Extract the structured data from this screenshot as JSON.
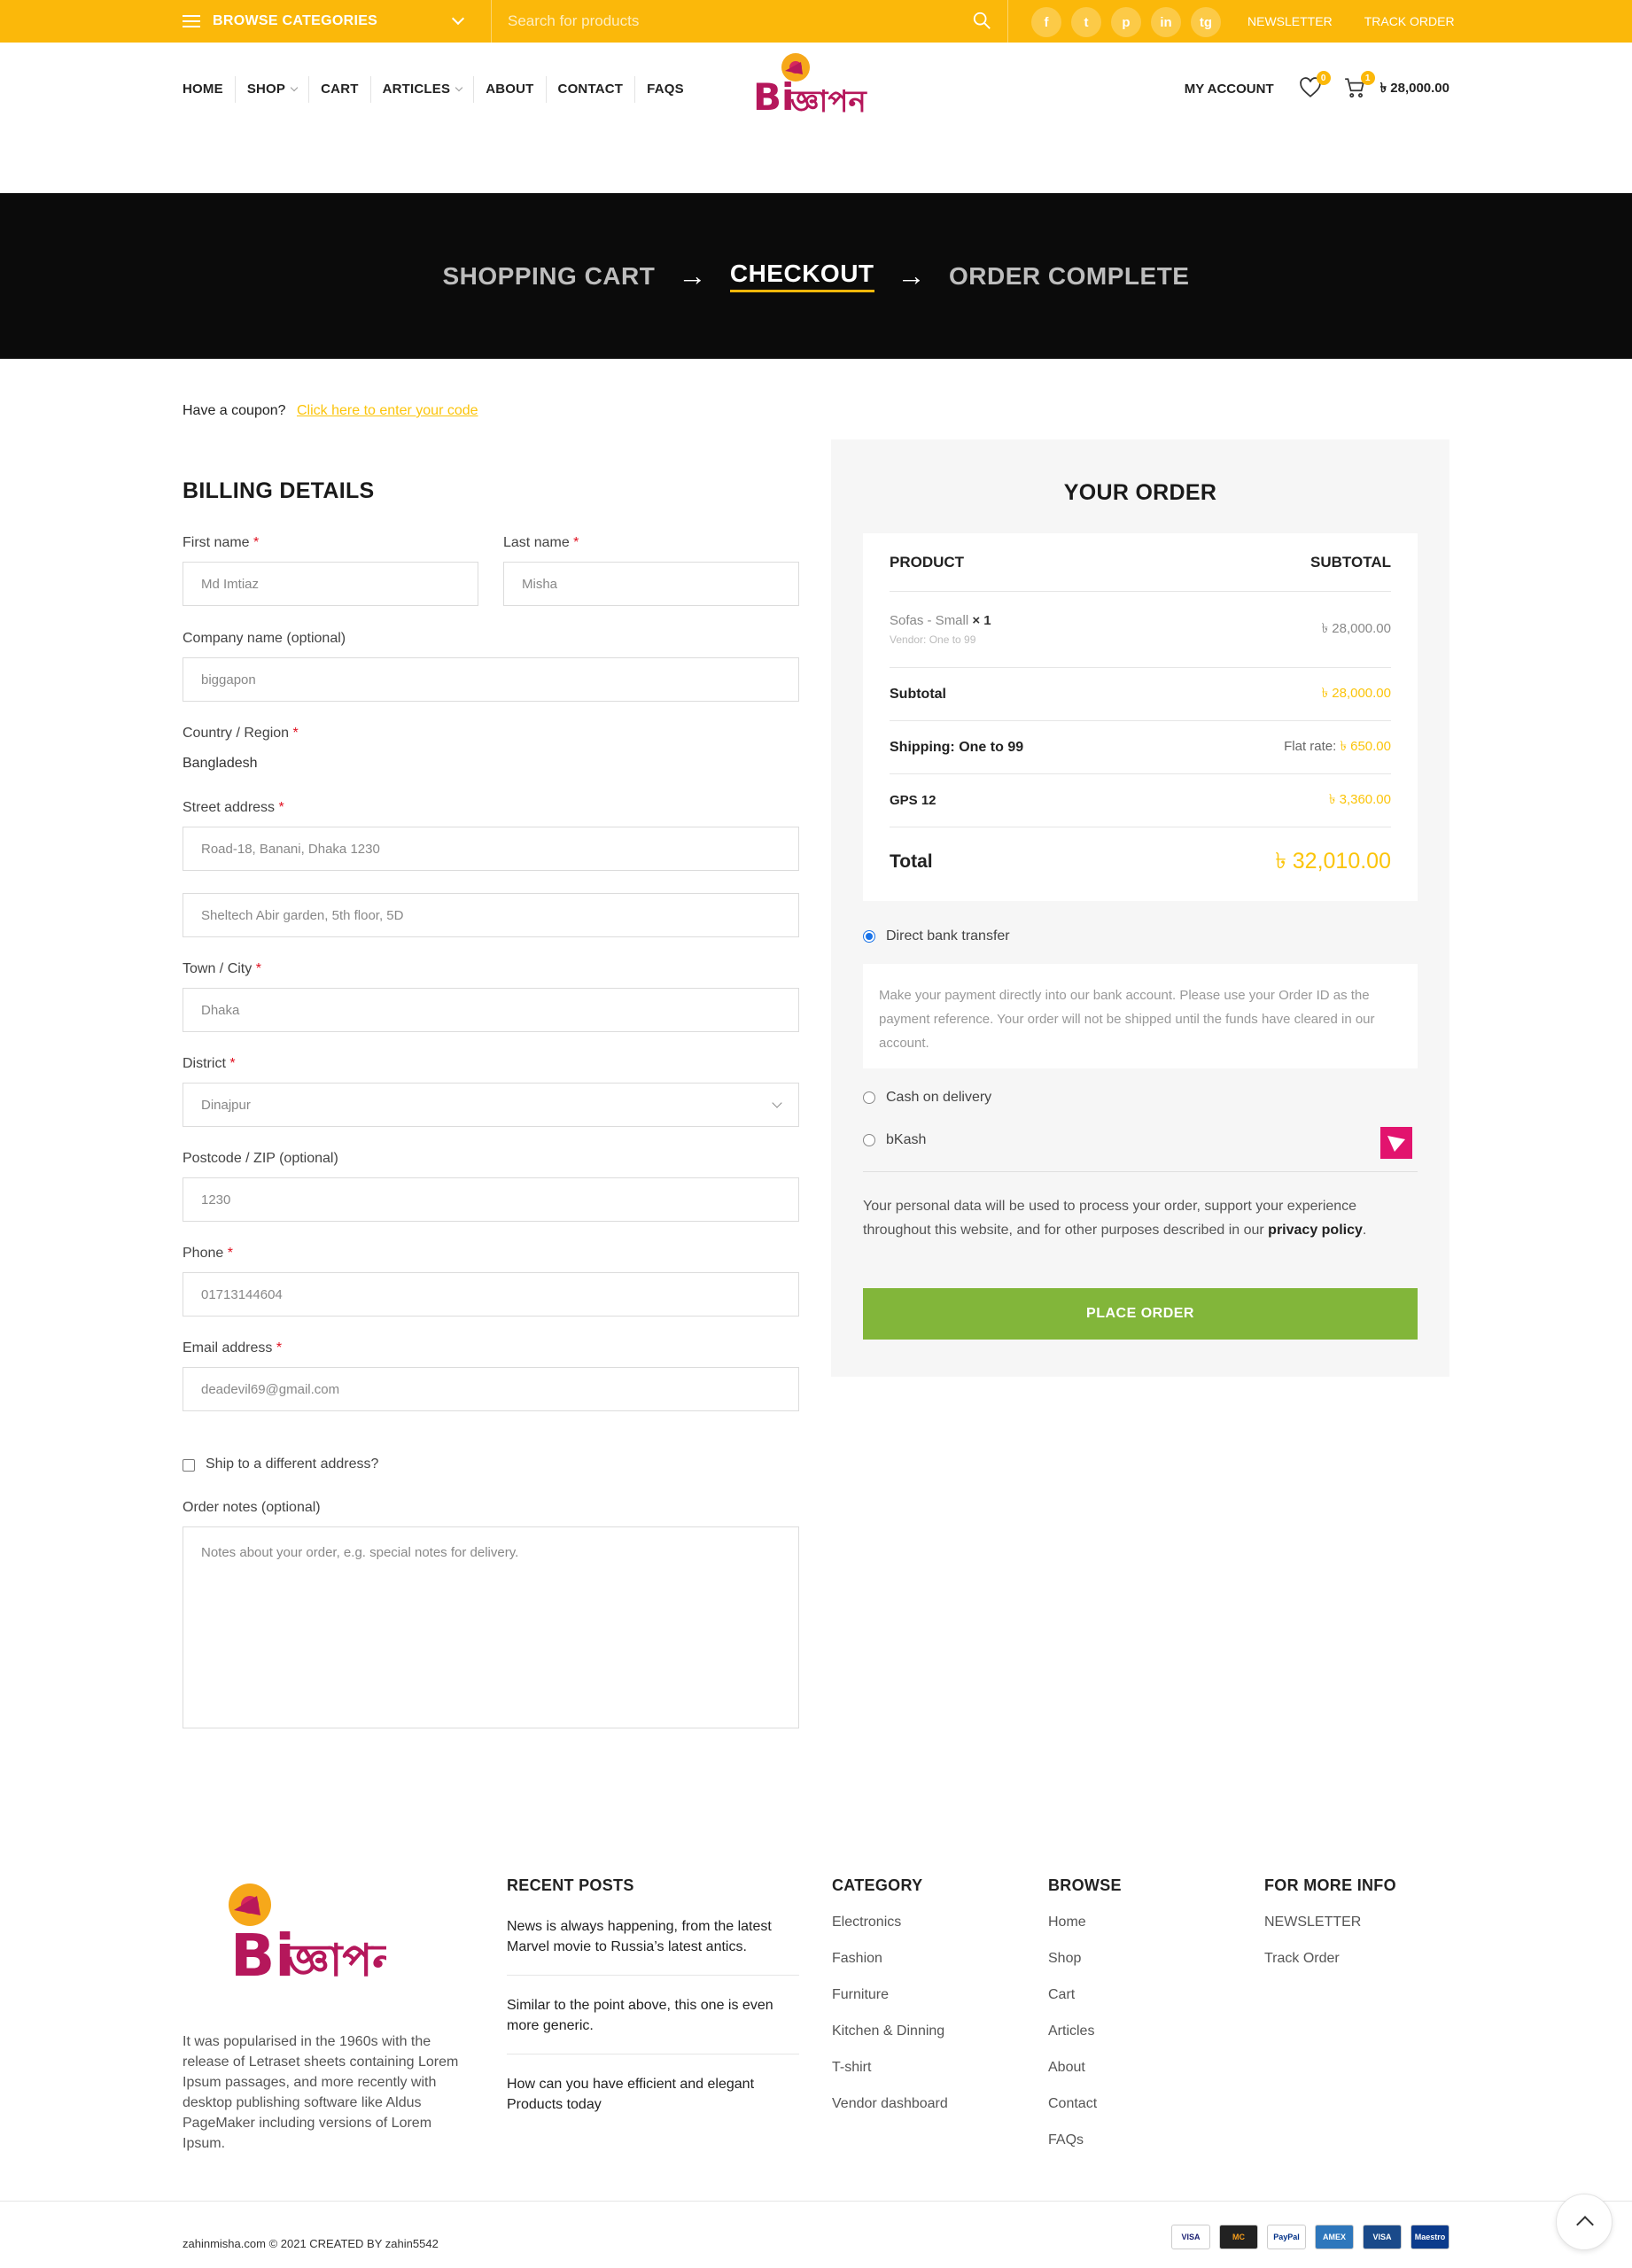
{
  "topbar": {
    "browse_label": "BROWSE CATEGORIES",
    "search_placeholder": "Search for products",
    "socials": [
      "f",
      "t",
      "p",
      "in",
      "tg"
    ],
    "links": [
      "NEWSLETTER",
      "TRACK ORDER"
    ]
  },
  "nav": {
    "items": [
      "HOME",
      "SHOP",
      "CART",
      "ARTICLES",
      "ABOUT",
      "CONTACT",
      "FAQS"
    ],
    "my_account": "MY ACCOUNT",
    "wishlist_count": "0",
    "cart_count": "1",
    "cart_total": "৳ 28,000.00"
  },
  "logo": {
    "text_left": "Bi",
    "text_right": "জ্ঞাপন"
  },
  "steps": {
    "cart": "SHOPPING CART",
    "checkout": "CHECKOUT",
    "complete": "ORDER COMPLETE"
  },
  "coupon": {
    "text": "Have a coupon?",
    "link": "Click here to enter your code"
  },
  "billing": {
    "title": "BILLING DETAILS",
    "first_name_label": "First name",
    "first_name": "Md Imtiaz",
    "last_name_label": "Last name",
    "last_name": "Misha",
    "company_label": "Company name (optional)",
    "company": "biggapon",
    "country_label": "Country / Region",
    "country": "Bangladesh",
    "street_label": "Street address",
    "street1": "Road-18, Banani, Dhaka 1230",
    "street2": "Sheltech Abir garden, 5th floor, 5D",
    "town_label": "Town / City",
    "town": "Dhaka",
    "district_label": "District",
    "district": "Dinajpur",
    "postcode_label": "Postcode / ZIP (optional)",
    "postcode": "1230",
    "phone_label": "Phone",
    "phone": "01713144604",
    "email_label": "Email address",
    "email": "deadevil69@gmail.com",
    "ship_diff": "Ship to a different address?",
    "notes_label": "Order notes (optional)",
    "notes_placeholder": "Notes about your order, e.g. special notes for delivery."
  },
  "order": {
    "title": "YOUR ORDER",
    "col_product": "PRODUCT",
    "col_subtotal": "SUBTOTAL",
    "item_name": "Sofas - Small",
    "item_qty": "× 1",
    "item_vendor": "Vendor: One to 99",
    "item_price": "৳ 28,000.00",
    "subtotal_label": "Subtotal",
    "subtotal": "৳ 28,000.00",
    "shipping_label": "Shipping: One to 99",
    "shipping_prefix": "Flat rate:",
    "shipping": "৳ 650.00",
    "gps_label": "GPS 12",
    "gps": "৳ 3,360.00",
    "total_label": "Total",
    "total": "৳ 32,010.00",
    "pay_bank": "Direct bank transfer",
    "pay_bank_desc": "Make your payment directly into our bank account. Please use your Order ID as the payment reference. Your order will not be shipped until the funds have cleared in our account.",
    "pay_cod": "Cash on delivery",
    "pay_bkash": "bKash",
    "privacy_text": "Your personal data will be used to process your order, support your experience throughout this website, and for other purposes described in our",
    "privacy_link": "privacy policy",
    "place_order": "PLACE ORDER"
  },
  "footer": {
    "desc": "It was popularised in the 1960s with the release of Letraset sheets containing Lorem Ipsum passages, and more recently with desktop publishing software like Aldus PageMaker including versions of Lorem Ipsum.",
    "recent_title": "RECENT POSTS",
    "posts": [
      "News is always happening, from the latest Marvel movie to Russia’s latest antics.",
      "Similar to the point above, this one is even more generic.",
      "How can you have efficient and elegant Products today"
    ],
    "category_title": "CATEGORY",
    "categories": [
      "Electronics",
      "Fashion",
      "Furniture",
      "Kitchen & Dinning",
      "T-shirt",
      "Vendor dashboard"
    ],
    "browse_title": "BROWSE",
    "browse": [
      "Home",
      "Shop",
      "Cart",
      "Articles",
      "About",
      "Contact",
      "FAQs"
    ],
    "info_title": "FOR MORE INFO",
    "info": [
      "NEWSLETTER",
      "Track Order"
    ],
    "copyright_site": "zahinmisha.com",
    "copyright_rest": "© 2021 CREATED BY",
    "copyright_author": "zahin5542",
    "cards": [
      "VISA",
      "MC",
      "PayPal",
      "AMEX",
      "VISA",
      "Maestro"
    ]
  }
}
